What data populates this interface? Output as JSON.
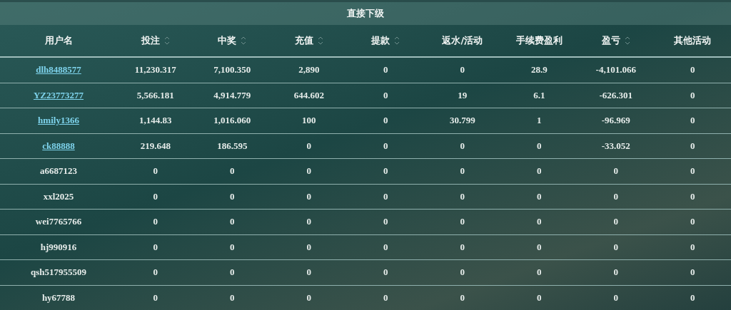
{
  "title": "直接下级",
  "columns": [
    {
      "label": "用户名",
      "sortable": false
    },
    {
      "label": "投注",
      "sortable": true
    },
    {
      "label": "中奖",
      "sortable": true
    },
    {
      "label": "充值",
      "sortable": true
    },
    {
      "label": "提款",
      "sortable": true
    },
    {
      "label": "返水/活动",
      "sortable": false
    },
    {
      "label": "手续费盈利",
      "sortable": false
    },
    {
      "label": "盈亏",
      "sortable": true
    },
    {
      "label": "其他活动",
      "sortable": false
    }
  ],
  "rows": [
    {
      "user": "dlh8488577",
      "linked": true,
      "cells": [
        "11,230.317",
        "7,100.350",
        "2,890",
        "0",
        "0",
        "28.9",
        "-4,101.066",
        "0"
      ]
    },
    {
      "user": "YZ23773277",
      "linked": true,
      "cells": [
        "5,566.181",
        "4,914.779",
        "644.602",
        "0",
        "19",
        "6.1",
        "-626.301",
        "0"
      ]
    },
    {
      "user": "hmily1366",
      "linked": true,
      "cells": [
        "1,144.83",
        "1,016.060",
        "100",
        "0",
        "30.799",
        "1",
        "-96.969",
        "0"
      ]
    },
    {
      "user": "ck88888",
      "linked": true,
      "cells": [
        "219.648",
        "186.595",
        "0",
        "0",
        "0",
        "0",
        "-33.052",
        "0"
      ]
    },
    {
      "user": "a6687123",
      "linked": false,
      "cells": [
        "0",
        "0",
        "0",
        "0",
        "0",
        "0",
        "0",
        "0"
      ]
    },
    {
      "user": "xxl2025",
      "linked": false,
      "cells": [
        "0",
        "0",
        "0",
        "0",
        "0",
        "0",
        "0",
        "0"
      ]
    },
    {
      "user": "wei7765766",
      "linked": false,
      "cells": [
        "0",
        "0",
        "0",
        "0",
        "0",
        "0",
        "0",
        "0"
      ]
    },
    {
      "user": "hj990916",
      "linked": false,
      "cells": [
        "0",
        "0",
        "0",
        "0",
        "0",
        "0",
        "0",
        "0"
      ]
    },
    {
      "user": "qsh517955509",
      "linked": false,
      "cells": [
        "0",
        "0",
        "0",
        "0",
        "0",
        "0",
        "0",
        "0"
      ]
    },
    {
      "user": "hy67788",
      "linked": false,
      "cells": [
        "0",
        "0",
        "0",
        "0",
        "0",
        "0",
        "0",
        "0"
      ]
    }
  ]
}
